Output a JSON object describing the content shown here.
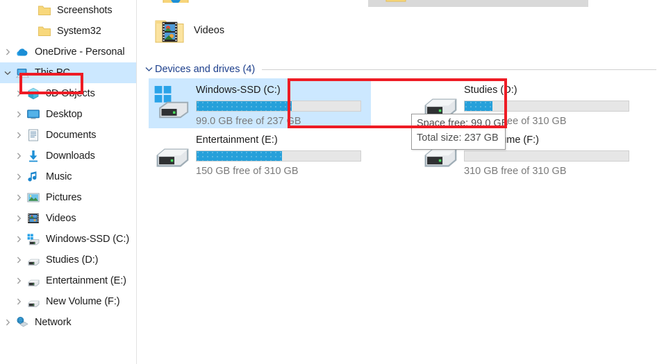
{
  "window": {
    "app": "File Explorer",
    "location": "This PC"
  },
  "nav_pane": {
    "items": [
      {
        "label": "Screenshots",
        "icon": "folder-icon",
        "depth": 2,
        "chevron": "none",
        "selected": false
      },
      {
        "label": "System32",
        "icon": "folder-icon",
        "depth": 2,
        "chevron": "none",
        "selected": false
      },
      {
        "label": "OneDrive - Personal",
        "icon": "onedrive-icon",
        "depth": 0,
        "chevron": "collapsed",
        "selected": false
      },
      {
        "label": "This PC",
        "icon": "this-pc-icon",
        "depth": 0,
        "chevron": "expanded",
        "selected": true
      },
      {
        "label": "3D Objects",
        "icon": "3d-objects-icon",
        "depth": 1,
        "chevron": "collapsed",
        "selected": false
      },
      {
        "label": "Desktop",
        "icon": "desktop-icon",
        "depth": 1,
        "chevron": "collapsed",
        "selected": false
      },
      {
        "label": "Documents",
        "icon": "documents-icon",
        "depth": 1,
        "chevron": "collapsed",
        "selected": false
      },
      {
        "label": "Downloads",
        "icon": "downloads-icon",
        "depth": 1,
        "chevron": "collapsed",
        "selected": false
      },
      {
        "label": "Music",
        "icon": "music-icon",
        "depth": 1,
        "chevron": "collapsed",
        "selected": false
      },
      {
        "label": "Pictures",
        "icon": "pictures-icon",
        "depth": 1,
        "chevron": "collapsed",
        "selected": false
      },
      {
        "label": "Videos",
        "icon": "videos-icon",
        "depth": 1,
        "chevron": "collapsed",
        "selected": false
      },
      {
        "label": "Windows-SSD (C:)",
        "icon": "windows-drive-icon",
        "depth": 1,
        "chevron": "collapsed",
        "selected": false
      },
      {
        "label": "Studies (D:)",
        "icon": "drive-icon",
        "depth": 1,
        "chevron": "collapsed",
        "selected": false
      },
      {
        "label": "Entertainment (E:)",
        "icon": "drive-icon",
        "depth": 1,
        "chevron": "collapsed",
        "selected": false
      },
      {
        "label": "New Volume (F:)",
        "icon": "drive-icon",
        "depth": 1,
        "chevron": "collapsed",
        "selected": false
      },
      {
        "label": "Network",
        "icon": "network-icon",
        "depth": 0,
        "chevron": "collapsed",
        "selected": false
      }
    ]
  },
  "content": {
    "folders_above": {
      "videos_label": "Videos"
    },
    "group": {
      "title": "Devices and drives (4)",
      "chevron": "expanded"
    },
    "drives": [
      {
        "name": "Windows-SSD (C:)",
        "meta": "99.0 GB free of 237 GB",
        "free_gb": 99.0,
        "total_gb": 237,
        "used_percent": 58,
        "icon": "windows-drive-icon",
        "selected": true,
        "column": "left"
      },
      {
        "name": "Entertainment (E:)",
        "meta": "150 GB free of 310 GB",
        "free_gb": 150,
        "total_gb": 310,
        "used_percent": 52,
        "icon": "drive-icon",
        "selected": false,
        "column": "left"
      },
      {
        "name": "Studies (D:)",
        "meta": "257 GB free of 310 GB",
        "free_gb": 257,
        "total_gb": 310,
        "used_percent": 17,
        "icon": "drive-icon",
        "selected": false,
        "column": "right"
      },
      {
        "name": "New Volume (F:)",
        "meta": "310 GB free of 310 GB",
        "free_gb": 310,
        "total_gb": 310,
        "used_percent": 0,
        "icon": "drive-icon",
        "selected": false,
        "column": "right"
      }
    ],
    "tooltip": {
      "line1": "Space free: 99.0 GB",
      "line2": "Total size: 237 GB"
    }
  },
  "annotations": {
    "highlight_color": "#ee1c25",
    "boxes": [
      {
        "target": "sidebar-item-this-pc"
      },
      {
        "target": "drive-tile-windows-ssd-c"
      }
    ]
  },
  "colors": {
    "selection_blue": "#cce8ff",
    "bar_fill": "#26a0da",
    "bar_track": "#e6e6e6",
    "group_header_blue": "#1d3f8c",
    "meta_gray": "#7a7a7a",
    "highlight_red": "#ee1c25"
  }
}
